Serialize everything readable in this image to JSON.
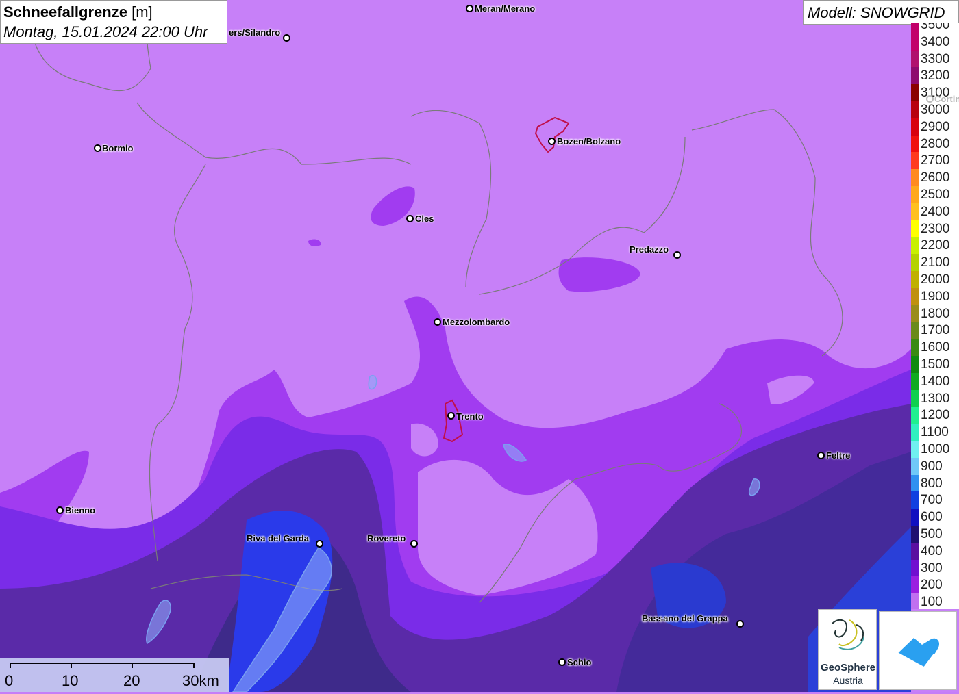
{
  "title": {
    "label": "Schneefallgrenze",
    "unit": "[m]",
    "datetime": "Montag, 15.01.2024 22:00 Uhr"
  },
  "model": {
    "label": "Modell: SNOWGRID"
  },
  "legend": {
    "items": [
      {
        "value": "3500",
        "color": "#c2006a"
      },
      {
        "value": "3400",
        "color": "#c2006a"
      },
      {
        "value": "3300",
        "color": "#b0106e"
      },
      {
        "value": "3200",
        "color": "#8e0a6e"
      },
      {
        "value": "3100",
        "color": "#8a0000"
      },
      {
        "value": "3000",
        "color": "#b80010"
      },
      {
        "value": "2900",
        "color": "#d80010"
      },
      {
        "value": "2800",
        "color": "#f01010"
      },
      {
        "value": "2700",
        "color": "#ff3a20"
      },
      {
        "value": "2600",
        "color": "#ff8a20"
      },
      {
        "value": "2500",
        "color": "#ffa81c"
      },
      {
        "value": "2400",
        "color": "#ffc020"
      },
      {
        "value": "2300",
        "color": "#ffff00"
      },
      {
        "value": "2200",
        "color": "#c8f000"
      },
      {
        "value": "2100",
        "color": "#b4d200"
      },
      {
        "value": "2000",
        "color": "#c0b000"
      },
      {
        "value": "1900",
        "color": "#c09010"
      },
      {
        "value": "1800",
        "color": "#9a8c1a"
      },
      {
        "value": "1700",
        "color": "#6a8a1a"
      },
      {
        "value": "1600",
        "color": "#3a8a12"
      },
      {
        "value": "1500",
        "color": "#108a10"
      },
      {
        "value": "1400",
        "color": "#10aa20"
      },
      {
        "value": "1300",
        "color": "#10d050"
      },
      {
        "value": "1200",
        "color": "#20f090"
      },
      {
        "value": "1100",
        "color": "#30f0c0"
      },
      {
        "value": "1000",
        "color": "#70f0f0"
      },
      {
        "value": "900",
        "color": "#70c8f8"
      },
      {
        "value": "800",
        "color": "#3090f0"
      },
      {
        "value": "700",
        "color": "#1040e0"
      },
      {
        "value": "600",
        "color": "#1010c0"
      },
      {
        "value": "500",
        "color": "#201070"
      },
      {
        "value": "400",
        "color": "#5a10a0"
      },
      {
        "value": "300",
        "color": "#7010d0"
      },
      {
        "value": "200",
        "color": "#9a20e0"
      },
      {
        "value": "100",
        "color": "#c070f0"
      }
    ]
  },
  "places": [
    {
      "id": "meran",
      "label": "Meran/Merano"
    },
    {
      "id": "schlanders",
      "label": "ers/Silandro"
    },
    {
      "id": "bormio",
      "label": "Bormio"
    },
    {
      "id": "bozen",
      "label": "Bozen/Bolzano"
    },
    {
      "id": "cles",
      "label": "Cles"
    },
    {
      "id": "predazzo",
      "label": "Predazzo"
    },
    {
      "id": "mezzolombardo",
      "label": "Mezzolombardo"
    },
    {
      "id": "trento",
      "label": "Trento"
    },
    {
      "id": "feltre",
      "label": "Feltre"
    },
    {
      "id": "bienno",
      "label": "Bienno"
    },
    {
      "id": "riva",
      "label": "Riva del Garda"
    },
    {
      "id": "rovereto",
      "label": "Rovereto"
    },
    {
      "id": "bassano",
      "label": "Bassano del Grappa"
    },
    {
      "id": "schio",
      "label": "Schio"
    },
    {
      "id": "cortina",
      "label": "Cortin"
    }
  ],
  "scalebar": {
    "labels": [
      "0",
      "10",
      "20",
      "30km"
    ]
  },
  "logos": {
    "geosphere_line1": "GeoSphere",
    "geosphere_line2": "Austria"
  }
}
